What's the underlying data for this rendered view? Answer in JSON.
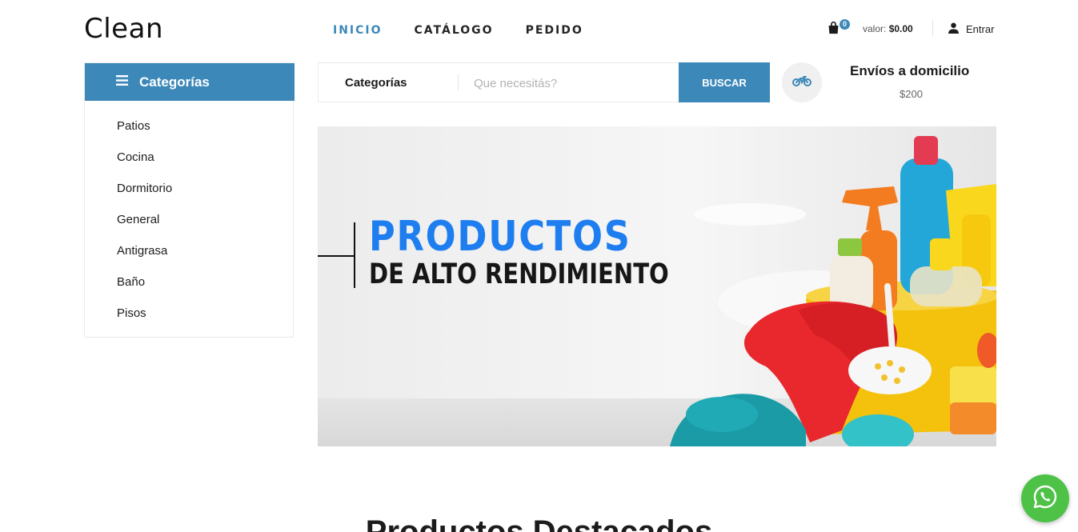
{
  "header": {
    "logo": "Clean",
    "nav": [
      {
        "label": "INICIO",
        "active": true
      },
      {
        "label": "CATÁLOGO",
        "active": false
      },
      {
        "label": "PEDIDO",
        "active": false
      }
    ],
    "cart_count": "0",
    "cart_value_label": "valor:",
    "cart_value": "$0.00",
    "login_label": "Entrar"
  },
  "sidebar": {
    "title": "Categorías",
    "items": [
      "Patios",
      "Cocina",
      "Dormitorio",
      "General",
      "Antigrasa",
      "Baño",
      "Pisos"
    ]
  },
  "search": {
    "category_label": "Categorías",
    "placeholder": "Que necesitás?",
    "button_label": "BUSCAR"
  },
  "shipping": {
    "title": "Envíos a domicilio",
    "price": "$200"
  },
  "banner": {
    "headline": "PRODUCTOS",
    "subheadline": "DE ALTO RENDIMIENTO"
  },
  "featured": {
    "title": "Productos Destacados"
  },
  "colors": {
    "accent": "#3c88b9",
    "banner_blue": "#1e7ef0",
    "whatsapp": "#4dc247"
  },
  "icons": {
    "cart": "shopping-bag-icon",
    "user": "user-icon",
    "menu": "hamburger-icon",
    "shipping": "motorcycle-icon",
    "whatsapp": "whatsapp-icon"
  }
}
